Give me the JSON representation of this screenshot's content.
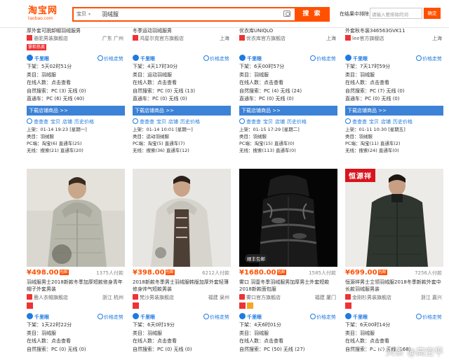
{
  "header": {
    "logo_title": "淘宝网",
    "logo_sub": "taobao.com",
    "search_scope": "宝贝",
    "search_query": "羽绒服",
    "search_button": "搜 索",
    "in_results_label": "在结果中排除",
    "in_results_placeholder": "请输入要排除的词",
    "confirm_button": "确定"
  },
  "top_row": [
    {
      "title": "厚外套可脱卸帽羽绒服男",
      "seller": "骆驼男装旗舰店",
      "location": "广东 广州",
      "badge": "掌柜热卖",
      "qianniu": "千里眼",
      "trend": "价格走势",
      "lines": [
        "下架：5天02时51分",
        "类目：羽绒服",
        "在线人数：点击查看",
        "自然搜索：PC (3) 无线 (0)",
        "直通车：PC (6) 无线 (40)"
      ],
      "download": "下载店铺商品 >>",
      "cc": [
        "查查查",
        "宝贝",
        "店铺",
        "历史价格"
      ],
      "small": [
        "上架：01-14 19:23 [星期一]",
        "类目：羽绒服",
        "PC端：淘宝(6)  直通车(25)",
        "无线：搜索(21) 直通车(20)"
      ]
    },
    {
      "title": "冬季运动羽绒服男",
      "seller": "鸿星尔克官方旗舰店",
      "location": "上海",
      "badge": "",
      "qianniu": "千里眼",
      "trend": "价格走势",
      "lines": [
        "下架：4天17时30分",
        "类目：运动羽绒服",
        "在线人数：点击查看",
        "自然搜索：PC (0) 无线 (13)",
        "直通车：PC (0) 无线 (0)"
      ],
      "download": "下载店铺商品 >>",
      "cc": [
        "查查查",
        "宝贝",
        "店铺",
        "历史价格"
      ],
      "small": [
        "上架：01-14 10:01 [星期一]",
        "类目：运动羽绒服",
        "PC端：淘宝(5)  直通车(7)",
        "无线：搜索(36) 直通车(12)"
      ]
    },
    {
      "title": "优衣库UNIQLO",
      "seller": "优衣库官方旗舰店",
      "location": "上海",
      "badge": "",
      "qianniu": "千里眼",
      "trend": "价格走势",
      "lines": [
        "下架：6天00时57分",
        "类目：羽绒服",
        "在线人数：点击查看",
        "自然搜索：PC (4) 无线 (24)",
        "直通车：PC (0) 无线 (0)"
      ],
      "download": "下载店铺商品 >>",
      "cc": [
        "查查查",
        "宝贝",
        "店铺",
        "历史价格"
      ],
      "small": [
        "上架：01-15 17:29 [星期二]",
        "类目：羽绒服",
        "PC端：淘宝(15)  直通车(0)",
        "无线：搜索(113) 直通车(0)"
      ]
    },
    {
      "title": "外套秋冬装346563GVK11",
      "seller": "lee官方旗舰店",
      "location": "上海",
      "badge": "",
      "qianniu": "千里眼",
      "trend": "价格走势",
      "lines": [
        "下架：7天17时59分",
        "类目：羽绒服",
        "在线人数：点击查看",
        "自然搜索：PC (7) 无线 (0)",
        "直通车：PC (0) 无线 (0)"
      ],
      "download": "下载店铺商品 >>",
      "cc": [
        "查查查",
        "宝贝",
        "店铺",
        "历史价格"
      ],
      "small": [
        "上架：01-11 10:30 [星期五]",
        "类目：羽绒服",
        "PC端：淘宝(11)  直通车(2)",
        "无线：搜索(24) 直通车(0)"
      ]
    }
  ],
  "bottom_row": [
    {
      "price": "¥498.00",
      "baoyou": "包邮",
      "paid": "1375人付款",
      "title": "羽绒服男士2018新款冬季加厚短款修身青年帽子外套男装",
      "seller": "鹿人衣帽旗舰店",
      "location": "浙江 杭州",
      "qianniu": "千里眼",
      "trend": "价格走势",
      "lines": [
        "下架：1天22时22分",
        "类目：羽绒服",
        "在线人数：点击查看",
        "自然搜索：PC (0) 无线 (0)"
      ]
    },
    {
      "price": "¥398.00",
      "baoyou": "包邮",
      "paid": "6212人付款",
      "title": "2018新款冬季男士羽绒服韩版加厚外套轻薄修身帅气短款男装",
      "seller": "梵沙男装旗舰店",
      "location": "福建 泉州",
      "qianniu": "千里眼",
      "trend": "价格走势",
      "lines": [
        "下架：6天0时19分",
        "类目：羽绒服",
        "在线人数：点击查看",
        "自然搜索：PC (0) 无线 (0)"
      ]
    },
    {
      "price": "¥1680.00",
      "baoyou": "包邮",
      "paid": "1585人付款",
      "title": "雾口 羽壹冬季羽绒服男加厚男士外套短款2018新款面包服",
      "seller": "雾口官方旗舰店",
      "location": "福建 厦门",
      "qianniu": "千里眼",
      "trend": "价格走势",
      "lines": [
        "下架：4天6时01分",
        "类目：羽绒服",
        "在线人数：点击查看",
        "自然搜索：PC (50) 无线 (27)"
      ],
      "sf_tag": "顺丰包邮"
    },
    {
      "price": "¥699.00",
      "baoyou": "包邮",
      "paid": "7256人付款",
      "title": "恒源祥男士立领羽绒服2018冬季新款外套中长款羽绒服男装",
      "seller": "金刚杉男装旗舰店",
      "location": "浙江 嘉兴",
      "qianniu": "千里眼",
      "trend": "价格走势",
      "lines": [
        "下架：6天00时14分",
        "类目：羽绒服",
        "在线人数：点击查看",
        "自然搜索：PC (0) 无线 (168)"
      ],
      "brand_tag": "恒源祥"
    }
  ],
  "watermark": "头条 @高空平"
}
